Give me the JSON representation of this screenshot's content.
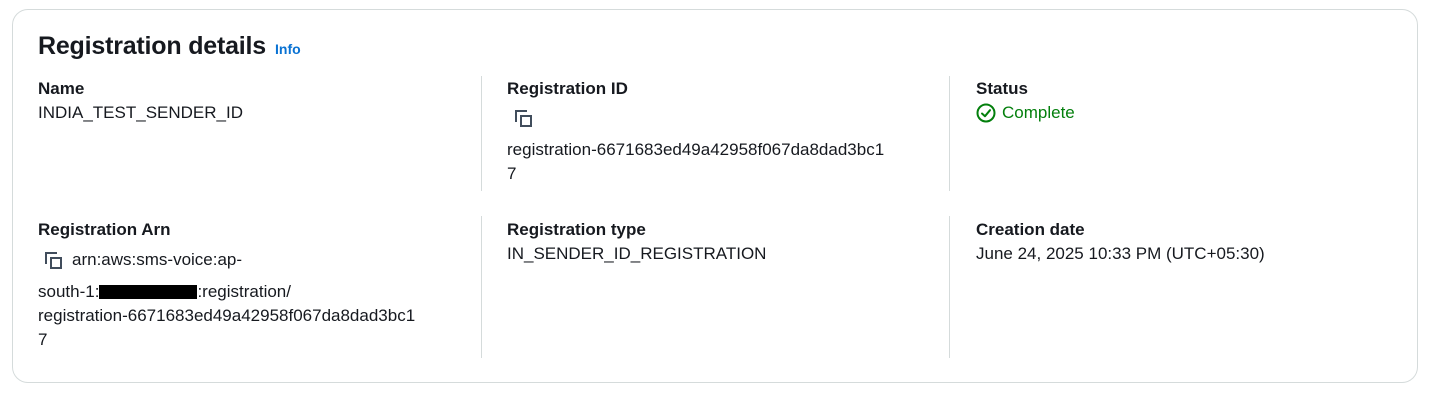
{
  "section": {
    "title": "Registration details",
    "info_label": "Info"
  },
  "fields": {
    "name": {
      "label": "Name",
      "value": "INDIA_TEST_SENDER_ID"
    },
    "registration_id": {
      "label": "Registration ID",
      "value_line1": "registration-6671683ed49a42958f067da8dad3bc1",
      "value_line2": "7"
    },
    "status": {
      "label": "Status",
      "value": "Complete",
      "color": "#037f0c"
    },
    "registration_arn": {
      "label": "Registration Arn",
      "value_line1": "arn:aws:sms-voice:ap-",
      "value_line2_prefix": "south-1:",
      "value_line2_suffix": ":registration/",
      "value_line3": "registration-6671683ed49a42958f067da8dad3bc1",
      "value_line4": "7"
    },
    "registration_type": {
      "label": "Registration type",
      "value": "IN_SENDER_ID_REGISTRATION"
    },
    "creation_date": {
      "label": "Creation date",
      "value": "June 24, 2025 10:33 PM (UTC+05:30)"
    }
  },
  "icons": {
    "copy": "copy-icon",
    "status": "check-circle-icon"
  },
  "colors": {
    "link": "#0972d3",
    "success": "#037f0c",
    "border": "#d5dbdb"
  }
}
